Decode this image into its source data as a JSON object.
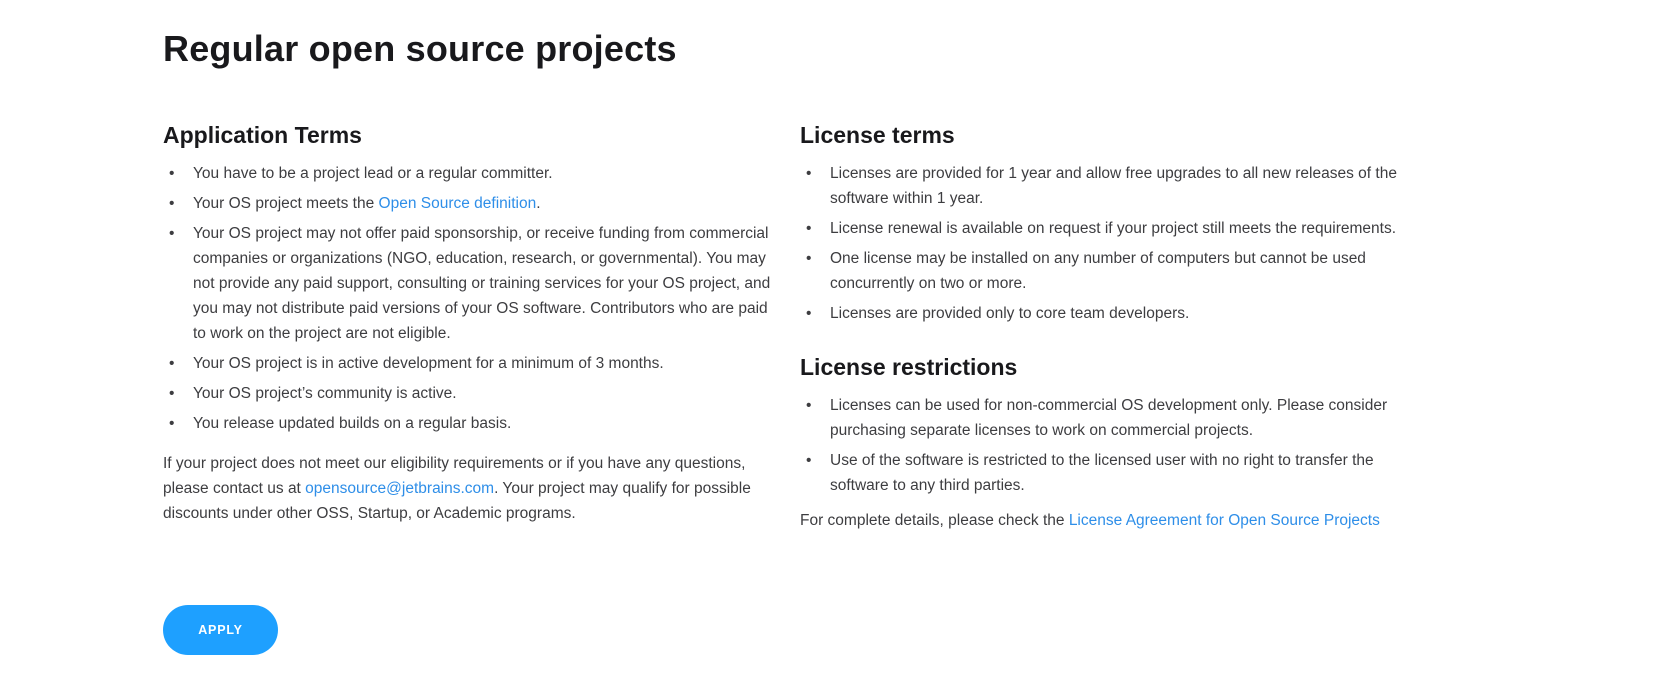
{
  "page_title": "Regular open source projects",
  "application_terms": {
    "title": "Application Terms",
    "items": [
      {
        "text": "You have to be a project lead or a regular committer."
      },
      {
        "before": "Your OS project meets the ",
        "link": "Open Source definition",
        "after": "."
      },
      {
        "text": "Your OS project may not offer paid sponsorship, or receive funding from commercial companies or organizations (NGO, education, research, or governmental). You may not provide any paid support, consulting or training services for your OS project, and you may not distribute paid versions of your OS software. Contributors who are paid to work on the project are not eligible."
      },
      {
        "text": "Your OS project is in active development for a minimum of 3 months."
      },
      {
        "text": "Your OS project’s community is active."
      },
      {
        "text": "You release updated builds on a regular basis."
      }
    ],
    "note": {
      "before": "If your project does not meet our eligibility requirements or if you have any questions, please contact us at ",
      "link": "opensource@jetbrains.com",
      "after": ". Your project may qualify for possible discounts under other OSS, Startup, or Academic programs."
    }
  },
  "license_terms": {
    "title": "License terms",
    "items": [
      {
        "text": "Licenses are provided for 1 year and allow free upgrades to all new releases of the software within 1 year."
      },
      {
        "text": "License renewal is available on request if your project still meets the requirements."
      },
      {
        "text": "One license may be installed on any number of computers but cannot be used concurrently on two or more."
      },
      {
        "text": "Licenses are provided only to core team developers."
      }
    ]
  },
  "license_restrictions": {
    "title": "License restrictions",
    "items": [
      {
        "text": "Licenses can be used for non-commercial OS development only. Please consider purchasing separate licenses to work on commercial projects."
      },
      {
        "text": "Use of the software is restricted to the licensed user with no right to transfer the software to any third parties."
      }
    ],
    "note": {
      "before": "For complete details, please check the ",
      "link": "License Agreement for Open Source Projects",
      "after": ""
    }
  },
  "bullet_char": "•",
  "apply_label": "APPLY",
  "colors": {
    "accent": "#1ea0ff",
    "link": "#2e8ee8",
    "heading": "#19191c",
    "body_text": "#3d3d40"
  }
}
